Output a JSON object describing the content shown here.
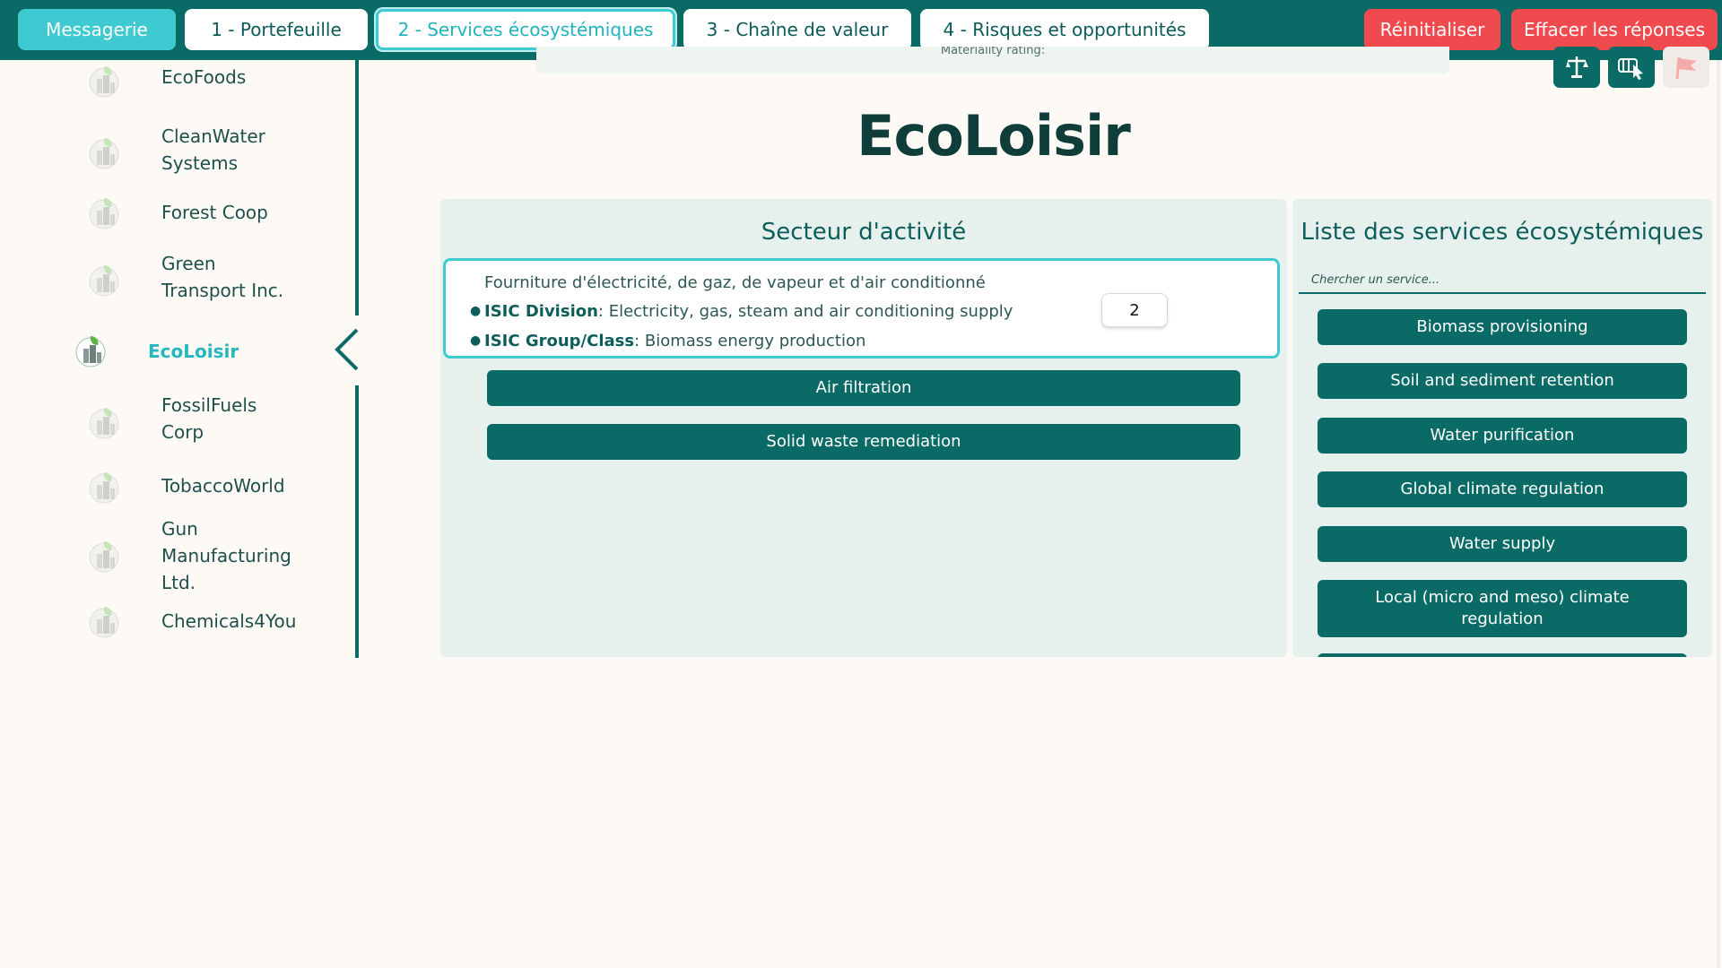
{
  "topbar": {
    "tabs": [
      {
        "label": "Messagerie"
      },
      {
        "label": "1 - Portefeuille"
      },
      {
        "label": "2 - Services écosystémiques"
      },
      {
        "label": "3 - Chaîne de valeur"
      },
      {
        "label": "4 - Risques et opportunités"
      }
    ],
    "reset_label": "Réinitialiser",
    "clear_label": "Effacer les réponses"
  },
  "banner_text": "Materiality rating:",
  "sidebar": {
    "companies": [
      {
        "name": "EcoFoods"
      },
      {
        "name": "CleanWater Systems"
      },
      {
        "name": "Forest Coop"
      },
      {
        "name": "Green Transport Inc."
      },
      {
        "name": "EcoLoisir",
        "selected": true
      },
      {
        "name": "FossilFuels Corp"
      },
      {
        "name": "TobaccoWorld"
      },
      {
        "name": "Gun Manufacturing Ltd."
      },
      {
        "name": "Chemicals4You"
      }
    ]
  },
  "main": {
    "company_title": "EcoLoisir",
    "sector": {
      "heading": "Secteur d'activité",
      "description": "Fourniture d'électricité, de gaz, de vapeur et d'air conditionné",
      "division_label": "ISIC Division",
      "division_value": ": Electricity, gas, steam and air conditioning supply",
      "group_label": "ISIC Group/Class",
      "group_value": ": Biomass energy production",
      "rating_value": "2",
      "selected_services": [
        "Air filtration",
        "Solid waste remediation"
      ]
    },
    "services_list": {
      "heading": "Liste des services écosystémiques",
      "search_placeholder": "Chercher un service...",
      "items": [
        "Biomass provisioning",
        "Soil and sediment retention",
        "Water purification",
        "Global climate regulation",
        "Water supply",
        "Local (micro and meso) climate regulation"
      ]
    }
  },
  "colors": {
    "primary": "#0a6b66",
    "accent": "#3ecad0",
    "danger": "#ef4b4e",
    "background": "#fdfaf6",
    "panel": "#e6f1ee"
  },
  "icons": [
    "scales-icon",
    "hand-pointer-icon",
    "flag-icon",
    "company-logo-icon",
    "chevron-left-icon"
  ]
}
